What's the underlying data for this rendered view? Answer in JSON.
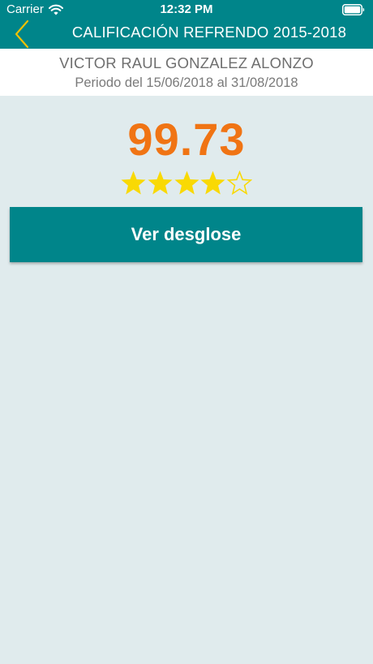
{
  "status_bar": {
    "carrier": "Carrier",
    "time": "12:32 PM",
    "wifi_icon": "wifi-icon",
    "battery_icon": "battery-icon"
  },
  "nav": {
    "back_icon": "chevron-left-icon",
    "title": "CALIFICACIÓN REFRENDO 2015-2018"
  },
  "header": {
    "name": "VICTOR RAUL GONZALEZ ALONZO",
    "period": "Periodo del 15/06/2018 al 31/08/2018"
  },
  "score": {
    "value": "99.73",
    "rating": 4,
    "rating_max": 5
  },
  "actions": {
    "breakdown_label": "Ver desglose"
  },
  "colors": {
    "primary": "#00858a",
    "accent": "#f07414",
    "star_fill": "#f9d904",
    "back_chevron": "#f0c000",
    "background": "#e0ebed"
  }
}
